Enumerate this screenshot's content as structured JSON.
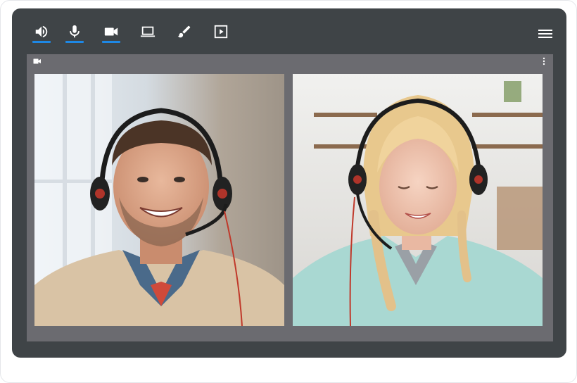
{
  "toolbar": {
    "buttons": [
      {
        "icon": "volume-icon",
        "active": true
      },
      {
        "icon": "microphone-icon",
        "active": true
      },
      {
        "icon": "video-camera-icon",
        "active": true
      },
      {
        "icon": "laptop-screen-share-icon",
        "active": false
      },
      {
        "icon": "paintbrush-icon",
        "active": false
      },
      {
        "icon": "play-box-icon",
        "active": false
      }
    ],
    "menu_icon": "hamburger-menu-icon"
  },
  "stage": {
    "header_icon": "video-camera-icon",
    "more_icon": "vertical-dots-icon",
    "participants": [
      {
        "id": "participant-man-headset",
        "description_icon": "video-feed"
      },
      {
        "id": "participant-girl-headset",
        "description_icon": "video-feed"
      }
    ]
  },
  "colors": {
    "window_bg": "#3f4447",
    "stage_bg": "#6b6b70",
    "active_underline": "#1e88e5",
    "icon": "#ffffff"
  }
}
